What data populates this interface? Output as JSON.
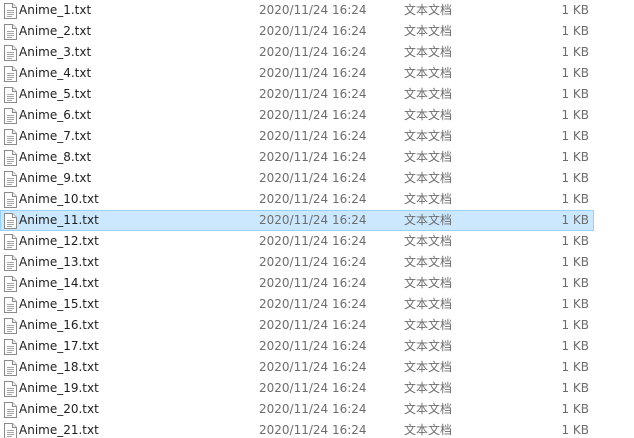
{
  "files": [
    {
      "name": "Anime_1.txt",
      "date": "2020/11/24 16:24",
      "type": "文本文档",
      "size": "1 KB",
      "selected": false
    },
    {
      "name": "Anime_2.txt",
      "date": "2020/11/24 16:24",
      "type": "文本文档",
      "size": "1 KB",
      "selected": false
    },
    {
      "name": "Anime_3.txt",
      "date": "2020/11/24 16:24",
      "type": "文本文档",
      "size": "1 KB",
      "selected": false
    },
    {
      "name": "Anime_4.txt",
      "date": "2020/11/24 16:24",
      "type": "文本文档",
      "size": "1 KB",
      "selected": false
    },
    {
      "name": "Anime_5.txt",
      "date": "2020/11/24 16:24",
      "type": "文本文档",
      "size": "1 KB",
      "selected": false
    },
    {
      "name": "Anime_6.txt",
      "date": "2020/11/24 16:24",
      "type": "文本文档",
      "size": "1 KB",
      "selected": false
    },
    {
      "name": "Anime_7.txt",
      "date": "2020/11/24 16:24",
      "type": "文本文档",
      "size": "1 KB",
      "selected": false
    },
    {
      "name": "Anime_8.txt",
      "date": "2020/11/24 16:24",
      "type": "文本文档",
      "size": "1 KB",
      "selected": false
    },
    {
      "name": "Anime_9.txt",
      "date": "2020/11/24 16:24",
      "type": "文本文档",
      "size": "1 KB",
      "selected": false
    },
    {
      "name": "Anime_10.txt",
      "date": "2020/11/24 16:24",
      "type": "文本文档",
      "size": "1 KB",
      "selected": false
    },
    {
      "name": "Anime_11.txt",
      "date": "2020/11/24 16:24",
      "type": "文本文档",
      "size": "1 KB",
      "selected": true
    },
    {
      "name": "Anime_12.txt",
      "date": "2020/11/24 16:24",
      "type": "文本文档",
      "size": "1 KB",
      "selected": false
    },
    {
      "name": "Anime_13.txt",
      "date": "2020/11/24 16:24",
      "type": "文本文档",
      "size": "1 KB",
      "selected": false
    },
    {
      "name": "Anime_14.txt",
      "date": "2020/11/24 16:24",
      "type": "文本文档",
      "size": "1 KB",
      "selected": false
    },
    {
      "name": "Anime_15.txt",
      "date": "2020/11/24 16:24",
      "type": "文本文档",
      "size": "1 KB",
      "selected": false
    },
    {
      "name": "Anime_16.txt",
      "date": "2020/11/24 16:24",
      "type": "文本文档",
      "size": "1 KB",
      "selected": false
    },
    {
      "name": "Anime_17.txt",
      "date": "2020/11/24 16:24",
      "type": "文本文档",
      "size": "1 KB",
      "selected": false
    },
    {
      "name": "Anime_18.txt",
      "date": "2020/11/24 16:24",
      "type": "文本文档",
      "size": "1 KB",
      "selected": false
    },
    {
      "name": "Anime_19.txt",
      "date": "2020/11/24 16:24",
      "type": "文本文档",
      "size": "1 KB",
      "selected": false
    },
    {
      "name": "Anime_20.txt",
      "date": "2020/11/24 16:24",
      "type": "文本文档",
      "size": "1 KB",
      "selected": false
    },
    {
      "name": "Anime_21.txt",
      "date": "2020/11/24 16:24",
      "type": "文本文档",
      "size": "1 KB",
      "selected": false
    }
  ],
  "icons": {
    "file": "text-document-icon"
  },
  "colors": {
    "selection_bg": "#cce8ff",
    "selection_border": "#99d1ff",
    "secondary_text": "#6d6d6d"
  }
}
